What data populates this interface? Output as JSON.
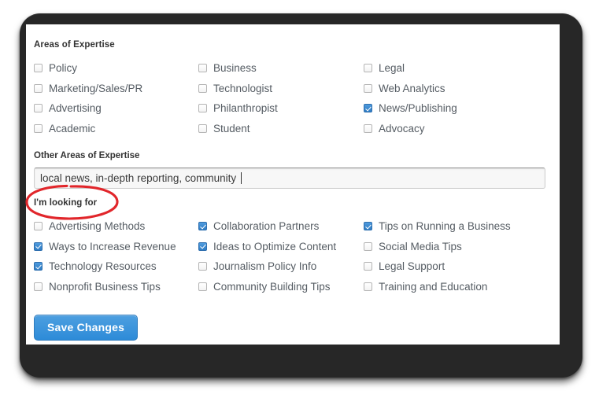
{
  "expertise": {
    "title": "Areas of Expertise",
    "rows": [
      [
        {
          "label": "Policy",
          "checked": false
        },
        {
          "label": "Business",
          "checked": false
        },
        {
          "label": "Legal",
          "checked": false
        }
      ],
      [
        {
          "label": "Marketing/Sales/PR",
          "checked": false
        },
        {
          "label": "Technologist",
          "checked": false
        },
        {
          "label": "Web Analytics",
          "checked": false
        }
      ],
      [
        {
          "label": "Advertising",
          "checked": false
        },
        {
          "label": "Philanthropist",
          "checked": false
        },
        {
          "label": "News/Publishing",
          "checked": true
        }
      ],
      [
        {
          "label": "Academic",
          "checked": false
        },
        {
          "label": "Student",
          "checked": false
        },
        {
          "label": "Advocacy",
          "checked": false
        }
      ]
    ]
  },
  "other_expertise": {
    "label": "Other Areas of Expertise",
    "value": "local news, in-depth reporting, community ",
    "placeholder": ""
  },
  "looking_for": {
    "title": "I'm looking for",
    "rows": [
      [
        {
          "label": "Advertising Methods",
          "checked": false
        },
        {
          "label": "Collaboration Partners",
          "checked": true
        },
        {
          "label": "Tips on Running a Business",
          "checked": true
        }
      ],
      [
        {
          "label": "Ways to Increase Revenue",
          "checked": true
        },
        {
          "label": "Ideas to Optimize Content",
          "checked": true
        },
        {
          "label": "Social Media Tips",
          "checked": false
        }
      ],
      [
        {
          "label": "Technology Resources",
          "checked": true
        },
        {
          "label": "Journalism Policy Info",
          "checked": false
        },
        {
          "label": "Legal Support",
          "checked": false
        }
      ],
      [
        {
          "label": "Nonprofit Business Tips",
          "checked": false
        },
        {
          "label": "Community Building Tips",
          "checked": false
        },
        {
          "label": "Training and Education",
          "checked": false
        }
      ]
    ]
  },
  "actions": {
    "save_label": "Save Changes"
  },
  "annotation": {
    "shape": "ellipse",
    "color": "#e1262b",
    "targets": "I'm looking for"
  },
  "colors": {
    "accent": "#3c91db",
    "checkbox_checked": "#2e7cc4",
    "annotation_red": "#e1262b",
    "bezel": "#272727",
    "label_text": "#555c63",
    "heading_text": "#333333"
  }
}
